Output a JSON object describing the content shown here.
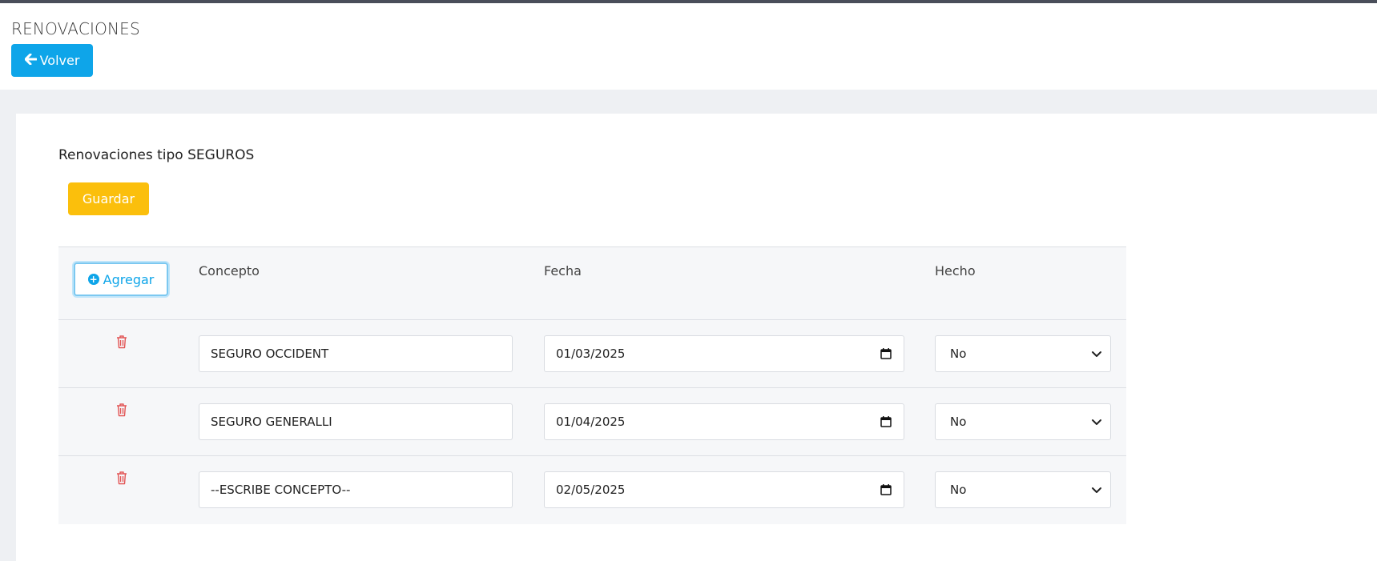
{
  "header": {
    "title": "RENOVACIONES",
    "back_label": "Volver"
  },
  "main": {
    "section_title": "Renovaciones tipo SEGUROS",
    "save_label": "Guardar",
    "add_label": "Agregar",
    "columns": [
      "Concepto",
      "Fecha",
      "Hecho"
    ],
    "rows": [
      {
        "concepto": "SEGURO OCCIDENT",
        "fecha": "01/03/2025",
        "hecho": "No"
      },
      {
        "concepto": "SEGURO GENERALLI",
        "fecha": "01/04/2025",
        "hecho": "No"
      },
      {
        "concepto": "--ESCRIBE CONCEPTO--",
        "fecha": "02/05/2025",
        "hecho": "No"
      }
    ]
  },
  "colors": {
    "primary": "#0ea5e9",
    "warning": "#fbbf0c",
    "danger": "#e25555"
  },
  "icons": {
    "back": "arrow-left-icon",
    "add": "plus-circle-icon",
    "delete": "trash-icon",
    "date": "calendar-icon",
    "select": "chevron-down-icon"
  }
}
